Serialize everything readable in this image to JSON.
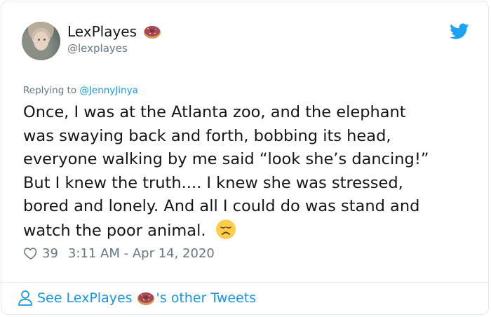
{
  "user": {
    "display_name": "LexPlayes",
    "handle": "@lexplayes",
    "avatar_icon": "avatar-photo",
    "name_emoji": "doughnut-icon"
  },
  "reply": {
    "prefix": "Replying to",
    "target": "@JennyJinya"
  },
  "tweet": {
    "lines": [
      "Once, I was at the Atlanta zoo, and the elephant",
      "was swaying back and forth, bobbing its head,",
      "everyone walking by me said “look she’s dancing!”",
      "But I knew the truth.... I knew she was stressed,",
      "bored and lonely. And all I could do was stand and",
      "watch the poor animal."
    ],
    "end_emoji": "disappointed-face-icon"
  },
  "meta": {
    "likes": "39",
    "timestamp": "3:11 AM - Apr 14, 2020"
  },
  "footer": {
    "see_prefix": "See LexPlayes",
    "see_suffix": "'s other Tweets"
  },
  "colors": {
    "link": "#1b95e0",
    "muted": "#657786",
    "text": "#14171a",
    "border": "#e1e8ed"
  }
}
